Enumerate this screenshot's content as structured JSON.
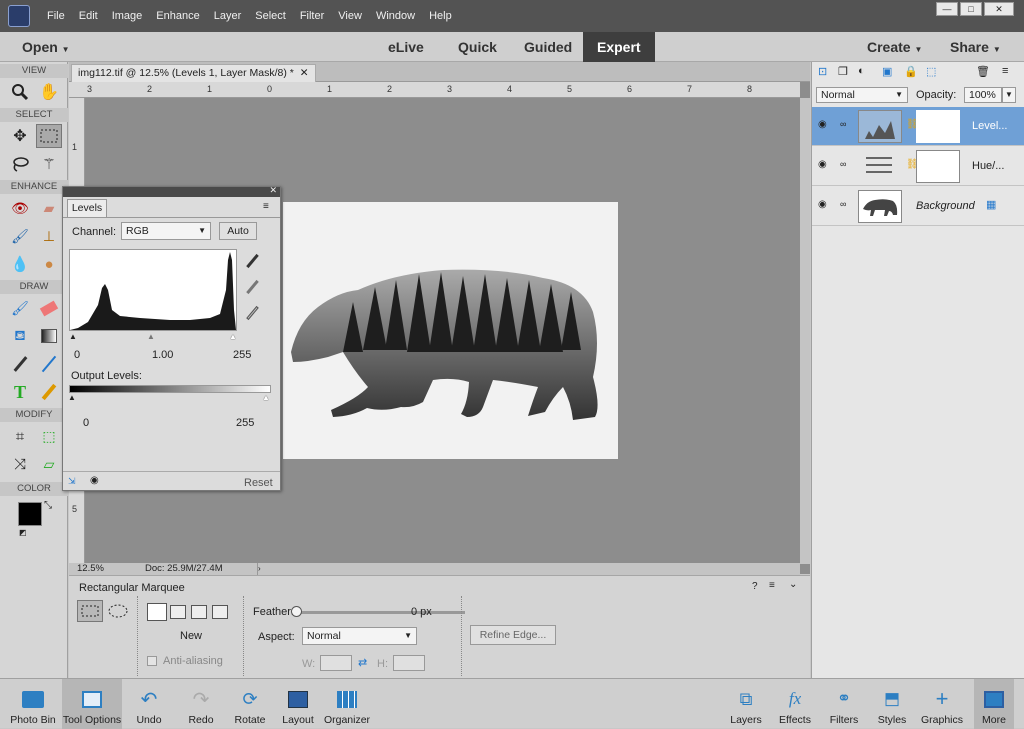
{
  "menubar": {
    "items": [
      "File",
      "Edit",
      "Image",
      "Enhance",
      "Layer",
      "Select",
      "Filter",
      "View",
      "Window",
      "Help"
    ]
  },
  "modebar": {
    "open": "Open",
    "modes": [
      "eLive",
      "Quick",
      "Guided",
      "Expert"
    ],
    "create": "Create",
    "share": "Share"
  },
  "toolbox": {
    "sections": [
      "VIEW",
      "SELECT",
      "ENHANCE",
      "DRAW",
      "MODIFY",
      "COLOR"
    ],
    "foreground": "#000000",
    "background": "#ffffff"
  },
  "document": {
    "tab": "img112.tif @ 12.5% (Levels 1, Layer Mask/8) *",
    "h_ruler": [
      "3",
      "2",
      "1",
      "0",
      "1",
      "2",
      "3",
      "4",
      "5",
      "6",
      "7",
      "8"
    ],
    "v_ruler": [
      "1",
      "5"
    ],
    "zoom": "12.5%",
    "doc_size": "Doc: 25.9M/27.4M"
  },
  "levels": {
    "tab": "Levels",
    "channel_label": "Channel:",
    "channel_value": "RGB",
    "auto": "Auto",
    "input_values": [
      "0",
      "1.00",
      "255"
    ],
    "output_label": "Output Levels:",
    "output_values": [
      "0",
      "255"
    ],
    "reset": "Reset"
  },
  "options": {
    "tool_name": "Rectangular Marquee",
    "new_label": "New",
    "antialias": "Anti-aliasing",
    "feather_label": "Feather:",
    "feather_value": "0 px",
    "feather_level": 0,
    "aspect_label": "Aspect:",
    "aspect_value": "Normal",
    "w_label": "W:",
    "h_label": "H:",
    "refine": "Refine Edge..."
  },
  "layers": {
    "blend_mode": "Normal",
    "opacity_label": "Opacity:",
    "opacity_value": "100%",
    "rows": [
      {
        "name": "Level..."
      },
      {
        "name": "Hue/..."
      },
      {
        "name": "Background"
      }
    ]
  },
  "bottombar": {
    "left": [
      "Photo Bin",
      "Tool Options",
      "Undo",
      "Redo",
      "Rotate",
      "Layout",
      "Organizer"
    ],
    "right": [
      "Layers",
      "Effects",
      "Filters",
      "Styles",
      "Graphics",
      "More"
    ]
  }
}
